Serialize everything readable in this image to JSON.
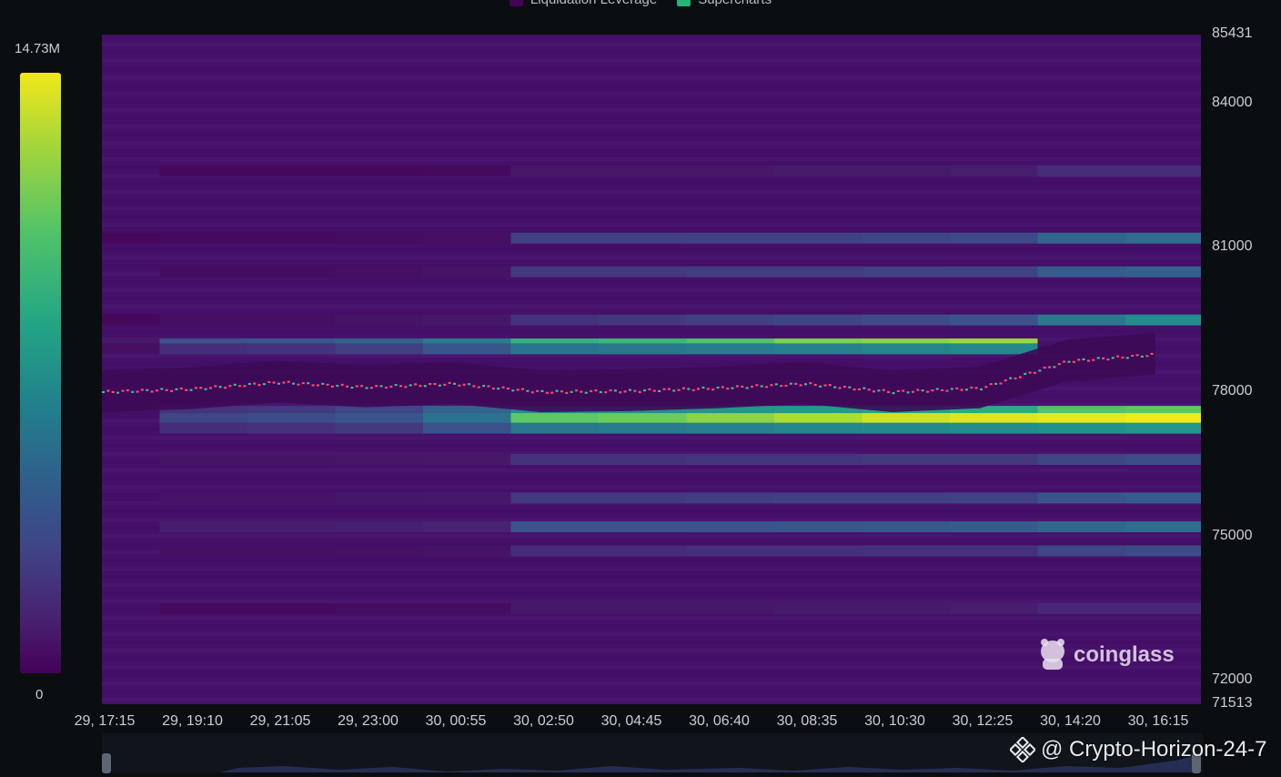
{
  "legend": {
    "items": [
      {
        "label": "Liquidation Leverage",
        "color": "#44015a"
      },
      {
        "label": "Supercharts",
        "color": "#22b573"
      }
    ]
  },
  "colorbar": {
    "max_label": "14.73M",
    "min_label": "0"
  },
  "watermark": {
    "text": "coinglass",
    "icon": "coinglass-mascot-icon"
  },
  "credit": {
    "text": "@ Crypto-Horizon-24-7",
    "icon": "binance-diamond-icon"
  },
  "chart_data": {
    "type": "heatmap",
    "title": "",
    "x_ticks": [
      "29, 17:15",
      "29, 19:10",
      "29, 21:05",
      "29, 23:00",
      "30, 00:55",
      "30, 02:50",
      "30, 04:45",
      "30, 06:40",
      "30, 08:35",
      "30, 10:30",
      "30, 12:25",
      "30, 14:20",
      "30, 16:15"
    ],
    "y_ticks": [
      85431,
      84000,
      81000,
      78000,
      75000,
      72000,
      71513
    ],
    "ylim": [
      71513,
      85431
    ],
    "zlim": [
      0,
      14730000
    ],
    "colorscale": "viridis",
    "liquidation_bands": [
      {
        "price": 82600,
        "intensity": [
          0.02,
          0.03,
          0.03,
          0.03,
          0.04,
          0.1,
          0.1,
          0.1,
          0.11,
          0.11,
          0.12,
          0.18,
          0.18
        ]
      },
      {
        "price": 81200,
        "intensity": [
          0.03,
          0.04,
          0.04,
          0.05,
          0.06,
          0.24,
          0.24,
          0.25,
          0.25,
          0.26,
          0.27,
          0.4,
          0.42
        ]
      },
      {
        "price": 80500,
        "intensity": [
          0.02,
          0.05,
          0.05,
          0.06,
          0.08,
          0.22,
          0.22,
          0.23,
          0.23,
          0.24,
          0.25,
          0.34,
          0.36
        ]
      },
      {
        "price": 79500,
        "intensity": [
          0.03,
          0.06,
          0.06,
          0.08,
          0.1,
          0.2,
          0.22,
          0.24,
          0.26,
          0.28,
          0.3,
          0.48,
          0.58
        ]
      },
      {
        "price": 79000,
        "intensity": [
          0.1,
          0.3,
          0.32,
          0.38,
          0.5,
          0.74,
          0.76,
          0.8,
          0.86,
          0.88,
          0.9,
          0.0,
          0.0
        ]
      },
      {
        "price": 78900,
        "intensity": [
          0.06,
          0.18,
          0.2,
          0.24,
          0.32,
          0.46,
          0.48,
          0.5,
          0.52,
          0.54,
          0.56,
          0.0,
          0.0
        ]
      },
      {
        "price": 77600,
        "intensity": [
          0.02,
          0.2,
          0.22,
          0.26,
          0.38,
          0.58,
          0.6,
          0.62,
          0.64,
          0.68,
          0.72,
          0.8,
          0.82
        ]
      },
      {
        "price": 77450,
        "intensity": [
          0.02,
          0.26,
          0.28,
          0.32,
          0.45,
          0.82,
          0.84,
          0.88,
          0.92,
          0.96,
          0.98,
          0.99,
          1.0
        ]
      },
      {
        "price": 77250,
        "intensity": [
          0.02,
          0.18,
          0.2,
          0.22,
          0.3,
          0.48,
          0.5,
          0.52,
          0.54,
          0.56,
          0.58,
          0.6,
          0.62
        ]
      },
      {
        "price": 76600,
        "intensity": [
          0.02,
          0.08,
          0.08,
          0.09,
          0.1,
          0.2,
          0.2,
          0.21,
          0.21,
          0.22,
          0.22,
          0.26,
          0.28
        ]
      },
      {
        "price": 75800,
        "intensity": [
          0.02,
          0.08,
          0.08,
          0.09,
          0.1,
          0.22,
          0.22,
          0.23,
          0.24,
          0.24,
          0.25,
          0.32,
          0.34
        ]
      },
      {
        "price": 75200,
        "intensity": [
          0.02,
          0.12,
          0.12,
          0.13,
          0.14,
          0.3,
          0.3,
          0.31,
          0.32,
          0.33,
          0.34,
          0.4,
          0.42
        ]
      },
      {
        "price": 74700,
        "intensity": [
          0.02,
          0.06,
          0.06,
          0.07,
          0.08,
          0.18,
          0.18,
          0.19,
          0.19,
          0.2,
          0.2,
          0.26,
          0.28
        ]
      },
      {
        "price": 73500,
        "intensity": [
          0.02,
          0.04,
          0.04,
          0.05,
          0.05,
          0.1,
          0.1,
          0.1,
          0.11,
          0.11,
          0.12,
          0.16,
          0.16
        ]
      }
    ],
    "price_series": {
      "name": "",
      "x": [
        "29, 17:15",
        "29, 19:10",
        "29, 21:05",
        "29, 23:00",
        "30, 00:55",
        "30, 02:50",
        "30, 04:45",
        "30, 06:40",
        "30, 08:35",
        "30, 10:30",
        "30, 12:25",
        "30, 14:20",
        "30, 16:15"
      ],
      "values": [
        78000,
        78060,
        78200,
        78100,
        78170,
        78000,
        78020,
        78080,
        78170,
        78000,
        78080,
        78640,
        78780
      ]
    }
  }
}
